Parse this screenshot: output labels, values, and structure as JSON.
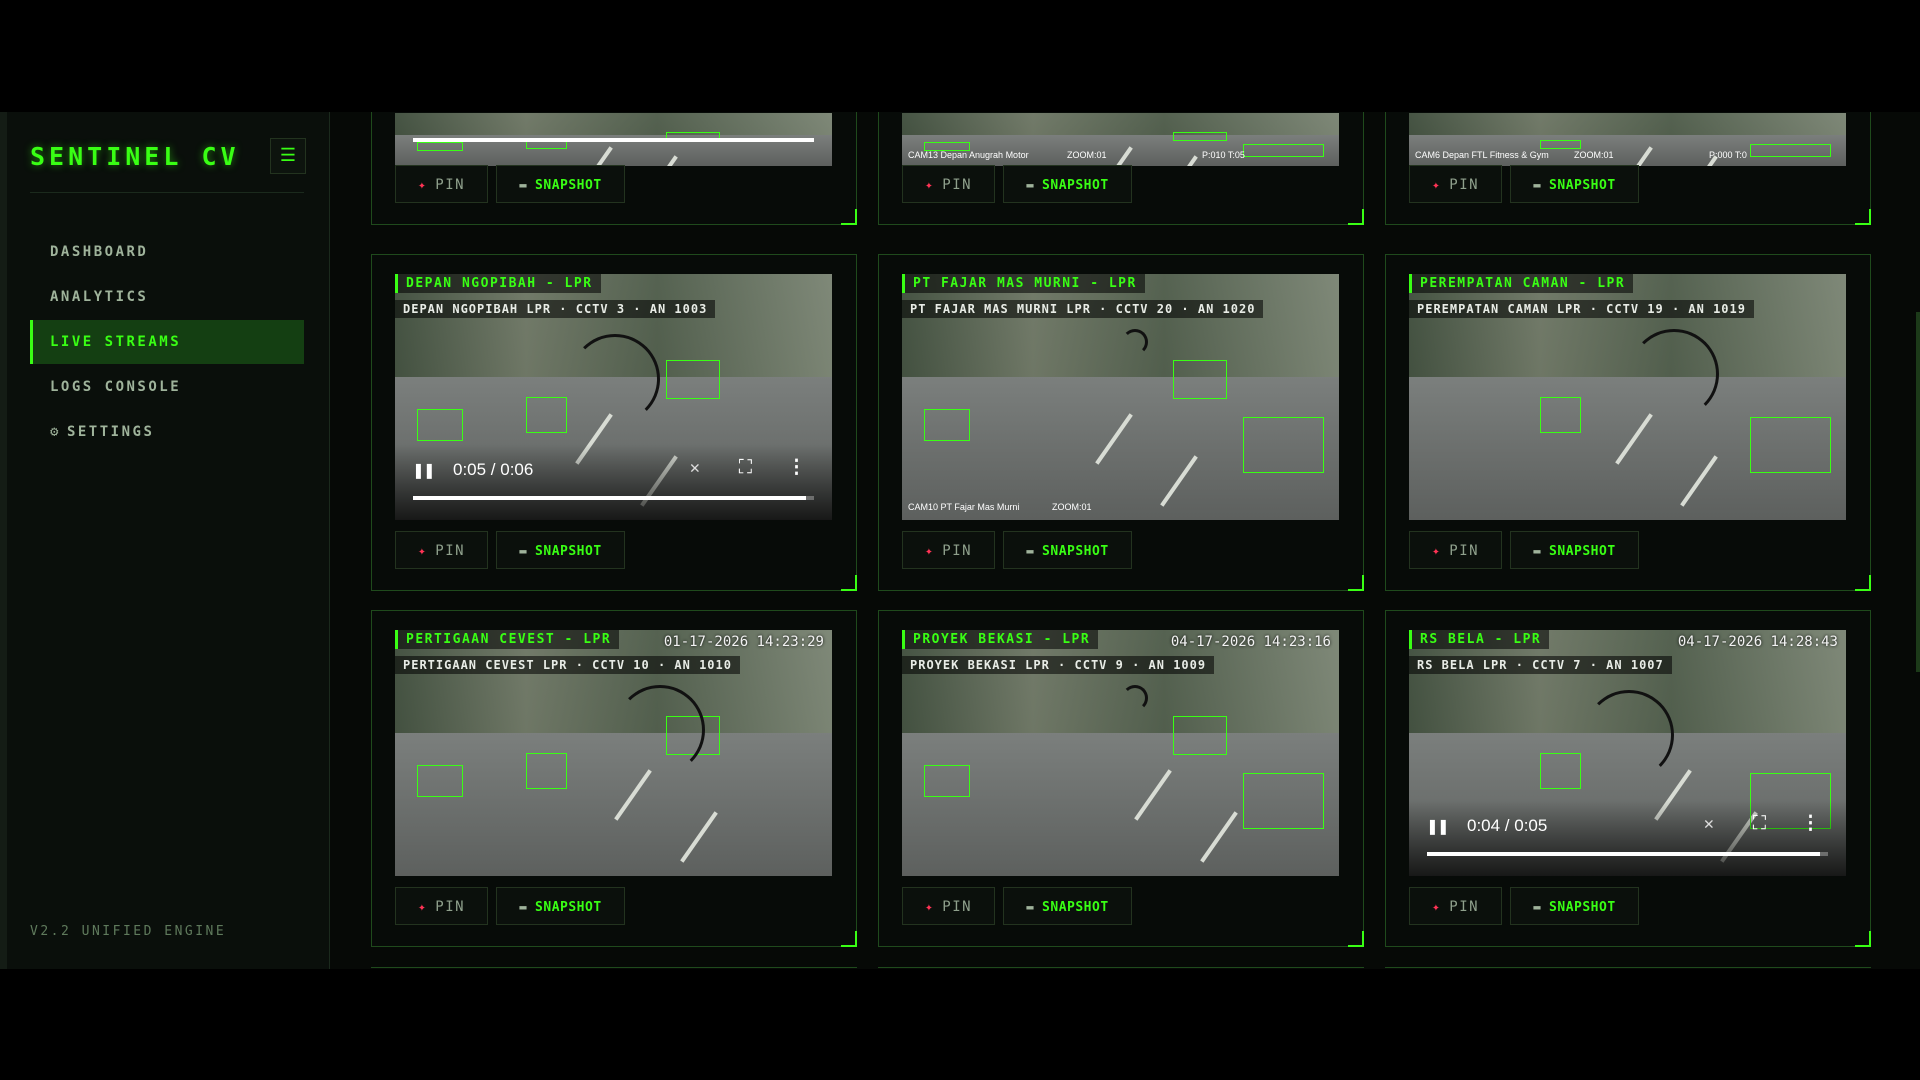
{
  "app": {
    "brand": "SENTINEL CV",
    "menu_icon": "☰",
    "version": "V2.2 UNIFIED ENGINE"
  },
  "nav": [
    {
      "label": "DASHBOARD",
      "active": false
    },
    {
      "label": "ANALYTICS",
      "active": false
    },
    {
      "label": "LIVE STREAMS",
      "active": true
    },
    {
      "label": "LOGS CONSOLE",
      "active": false
    },
    {
      "label": "SETTINGS",
      "active": false,
      "icon": "gear-icon"
    }
  ],
  "buttons": {
    "pin_label": "PIN",
    "snapshot_label": "SNAPSHOT"
  },
  "top_row": [
    {
      "overlay_text": "",
      "progress": 1.0
    },
    {
      "overlay_text": "CAM13 Depan Anugrah Motor",
      "zoom": "ZOOM:01",
      "extra": "P:010 T:05"
    },
    {
      "overlay_text": "CAM6 Depan FTL Fitness & Gym",
      "zoom": "ZOOM:01",
      "extra": "P:000 T:0"
    }
  ],
  "cameras": [
    {
      "title": "DEPAN NGOPIBAH - LPR",
      "subtitle": "DEPAN NGOPIBAH LPR · CCTV 3 · AN 1003",
      "time": "",
      "controls": true,
      "current": "0:05 / 0:06",
      "progress": 0.98
    },
    {
      "title": "PT FAJAR MAS MURNI - LPR",
      "subtitle": "PT FAJAR MAS MURNI LPR · CCTV 20 · AN 1020",
      "time": "",
      "controls": false,
      "overlay_text": "CAM10 PT Fajar Mas Murni",
      "zoom": "ZOOM:01"
    },
    {
      "title": "PEREMPATAN CAMAN - LPR",
      "subtitle": "PEREMPATAN CAMAN LPR · CCTV 19 · AN 1019",
      "time": "",
      "controls": false
    },
    {
      "title": "PERTIGAAN CEVEST - LPR",
      "subtitle": "PERTIGAAN CEVEST LPR · CCTV 10 · AN 1010",
      "time": "01-17-2026 14:23:29",
      "controls": false
    },
    {
      "title": "PROYEK BEKASI - LPR",
      "subtitle": "PROYEK BEKASI LPR · CCTV 9 · AN 1009",
      "time": "04-17-2026 14:23:16",
      "controls": false
    },
    {
      "title": "RS BELA - LPR",
      "subtitle": "RS BELA LPR · CCTV 7 · AN 1007",
      "time": "04-17-2026 14:28:43",
      "controls": true,
      "current": "0:04 / 0:05",
      "progress": 0.98
    }
  ],
  "colors": {
    "accent": "#39ff14",
    "active_bg": "#143f12",
    "pin": "#ff3355",
    "bg": "#060906"
  }
}
